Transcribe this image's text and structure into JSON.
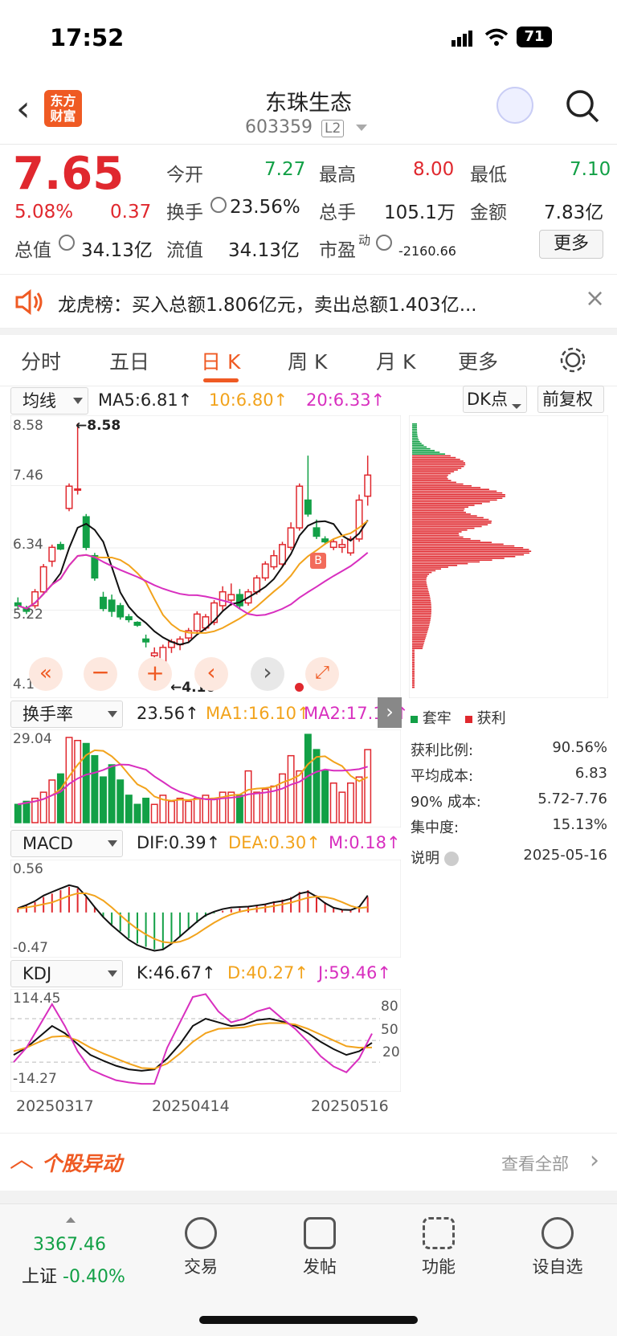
{
  "status": {
    "time": "17:52",
    "battery": "71"
  },
  "header": {
    "title": "东珠生态",
    "code": "603359",
    "level": "L2",
    "logo": "东方财富"
  },
  "quote": {
    "price": "7.65",
    "pct": "5.08%",
    "chg": "0.37",
    "open_l": "今开",
    "open": "7.27",
    "high_l": "最高",
    "high": "8.00",
    "low_l": "最低",
    "low": "7.10",
    "turn_l": "换手",
    "turn": "23.56%",
    "vol_l": "总手",
    "vol": "105.1万",
    "amt_l": "金额",
    "amt": "7.83亿",
    "mcap_l": "总值",
    "mcap": "34.13亿",
    "fcap_l": "流值",
    "fcap": "34.13亿",
    "pe_l": "市盈",
    "pe_sup": "动",
    "pe": "-2160.66",
    "more": "更多"
  },
  "notice": {
    "text": "龙虎榜：买入总额1.806亿元，卖出总额1.403亿..."
  },
  "tabs": [
    "分时",
    "五日",
    "日 K",
    "周 K",
    "月 K",
    "更多"
  ],
  "kline": {
    "select": "均线",
    "ma5": "MA5:6.81↑",
    "ma10": "10:6.80↑",
    "ma20": "20:6.33↑",
    "dk": "DK点",
    "fq": "前复权",
    "y_top": "8.58",
    "y2": "7.46",
    "y3": "6.34",
    "y4": "5.22",
    "y_bot": "4.10",
    "hi_mark": "←8.58",
    "lo_mark": "←4.10",
    "b_mark": "B"
  },
  "turnover": {
    "select": "换手率",
    "val": "23.56↑",
    "ma1": "MA1:16.10↑",
    "ma2": "MA2:17.18↑",
    "ymax": "29.04"
  },
  "macd": {
    "select": "MACD",
    "dif": "DIF:0.39↑",
    "dea": "DEA:0.30↑",
    "m": "M:0.18↑",
    "ytop": "0.56",
    "ybot": "-0.47"
  },
  "kdj": {
    "select": "KDJ",
    "k": "K:46.67↑",
    "d": "D:40.27↑",
    "j": "J:59.46↑",
    "ytop": "114.45",
    "ybot": "-14.27",
    "l80": "80",
    "l50": "50",
    "l20": "20"
  },
  "dates": [
    "20250317",
    "20250414",
    "20250516"
  ],
  "chips": {
    "legend_a": "套牢",
    "legend_b": "获利",
    "rows": [
      {
        "k": "获利比例:",
        "v": "90.56%"
      },
      {
        "k": "平均成本:",
        "v": "6.83"
      },
      {
        "k": "90% 成本:",
        "v": "5.72-7.76"
      },
      {
        "k": "集中度:",
        "v": "15.13%"
      }
    ],
    "note": "说明",
    "date": "2025-05-16"
  },
  "yidong": {
    "title": "个股异动",
    "more": "查看全部"
  },
  "bottom": {
    "index_val": "3367.46",
    "index_name": "上证",
    "index_pct": "-0.40%",
    "items": [
      "交易",
      "发帖",
      "功能",
      "设自选"
    ]
  },
  "chart_data": [
    {
      "type": "candlestick",
      "title": "日K",
      "ylim": [
        4.1,
        8.58
      ],
      "ma": {
        "MA5": 6.81,
        "MA10": 6.8,
        "MA20": 6.33
      },
      "candles": [
        [
          5.35,
          5.45,
          5.25,
          5.3
        ],
        [
          5.25,
          5.3,
          5.15,
          5.2
        ],
        [
          5.3,
          5.6,
          5.25,
          5.55
        ],
        [
          5.55,
          6.05,
          5.5,
          6.0
        ],
        [
          6.1,
          6.4,
          6.0,
          6.35
        ],
        [
          6.4,
          6.45,
          6.3,
          6.32
        ],
        [
          7.05,
          7.5,
          7.0,
          7.45
        ],
        [
          7.4,
          8.58,
          7.3,
          7.4
        ],
        [
          6.9,
          6.95,
          6.3,
          6.35
        ],
        [
          6.2,
          6.25,
          5.75,
          5.8
        ],
        [
          5.45,
          5.55,
          5.2,
          5.25
        ],
        [
          5.4,
          5.5,
          5.1,
          5.2
        ],
        [
          5.3,
          5.35,
          5.05,
          5.1
        ],
        [
          5.1,
          5.15,
          5.0,
          5.05
        ],
        [
          5.0,
          5.02,
          4.92,
          4.95
        ],
        [
          4.7,
          4.78,
          4.55,
          4.65
        ],
        [
          4.4,
          4.55,
          4.1,
          4.45
        ],
        [
          4.3,
          4.6,
          4.2,
          4.55
        ],
        [
          4.55,
          4.7,
          4.45,
          4.65
        ],
        [
          4.6,
          4.75,
          4.5,
          4.7
        ],
        [
          4.72,
          4.9,
          4.65,
          4.85
        ],
        [
          4.85,
          5.2,
          4.8,
          5.15
        ],
        [
          4.9,
          5.15,
          4.85,
          5.1
        ],
        [
          5.0,
          5.4,
          4.95,
          5.35
        ],
        [
          5.3,
          5.65,
          5.2,
          5.55
        ],
        [
          5.4,
          5.7,
          5.3,
          5.5
        ],
        [
          5.5,
          5.6,
          5.25,
          5.3
        ],
        [
          5.35,
          5.6,
          5.3,
          5.55
        ],
        [
          5.55,
          5.85,
          5.5,
          5.8
        ],
        [
          5.8,
          6.1,
          5.75,
          6.05
        ],
        [
          6.0,
          6.3,
          5.95,
          6.2
        ],
        [
          6.05,
          6.45,
          6.0,
          6.4
        ],
        [
          6.35,
          6.8,
          6.3,
          6.7
        ],
        [
          6.7,
          7.5,
          6.65,
          7.45
        ],
        [
          7.2,
          8.0,
          6.9,
          6.95
        ],
        [
          6.7,
          6.85,
          6.5,
          6.55
        ],
        [
          6.5,
          6.55,
          6.4,
          6.45
        ],
        [
          6.35,
          6.5,
          6.3,
          6.45
        ],
        [
          6.35,
          6.5,
          6.25,
          6.4
        ],
        [
          6.25,
          6.55,
          6.2,
          6.5
        ],
        [
          6.5,
          7.3,
          6.45,
          7.2
        ],
        [
          7.27,
          8.0,
          7.1,
          7.65
        ]
      ]
    },
    {
      "type": "bar",
      "title": "换手率",
      "ylim": [
        0,
        29.04
      ],
      "values": [
        6,
        7,
        8,
        10,
        14,
        16,
        28,
        27,
        26,
        22,
        15,
        19,
        14,
        9,
        6,
        8,
        6,
        9,
        7,
        8,
        7,
        8,
        9,
        8,
        10,
        10,
        9,
        17,
        10,
        11,
        12,
        16,
        22,
        17,
        29,
        24,
        17,
        13,
        10,
        13,
        15,
        24
      ]
    },
    {
      "type": "bar",
      "title": "MACD",
      "ylim": [
        -0.47,
        0.56
      ],
      "values": [
        0.05,
        0.08,
        0.12,
        0.18,
        0.22,
        0.26,
        0.3,
        0.28,
        0.18,
        0.06,
        -0.05,
        -0.14,
        -0.22,
        -0.3,
        -0.36,
        -0.4,
        -0.43,
        -0.42,
        -0.36,
        -0.28,
        -0.2,
        -0.12,
        -0.05,
        -0.01,
        0.02,
        0.04,
        0.05,
        0.06,
        0.08,
        0.1,
        0.13,
        0.15,
        0.18,
        0.24,
        0.26,
        0.2,
        0.12,
        0.06,
        0.03,
        0.02,
        0.05,
        0.18
      ]
    },
    {
      "type": "line",
      "title": "KDJ",
      "ylim": [
        -14.27,
        114.45
      ],
      "series": [
        {
          "name": "K",
          "values": [
            30,
            40,
            55,
            70,
            60,
            45,
            30,
            22,
            15,
            10,
            8,
            10,
            25,
            45,
            70,
            80,
            75,
            70,
            72,
            78,
            80,
            76,
            70,
            60,
            48,
            38,
            30,
            35,
            46.67
          ]
        },
        {
          "name": "D",
          "values": [
            35,
            40,
            48,
            55,
            56,
            50,
            40,
            32,
            25,
            18,
            12,
            11,
            18,
            32,
            48,
            60,
            66,
            67,
            68,
            72,
            74,
            74,
            72,
            66,
            58,
            50,
            42,
            40,
            40.27
          ]
        },
        {
          "name": "J",
          "values": [
            20,
            40,
            70,
            100,
            70,
            35,
            10,
            2,
            -5,
            -8,
            -10,
            -10,
            40,
            75,
            110,
            114,
            90,
            75,
            80,
            90,
            95,
            80,
            66,
            48,
            28,
            14,
            6,
            25,
            59.46
          ]
        }
      ]
    }
  ]
}
